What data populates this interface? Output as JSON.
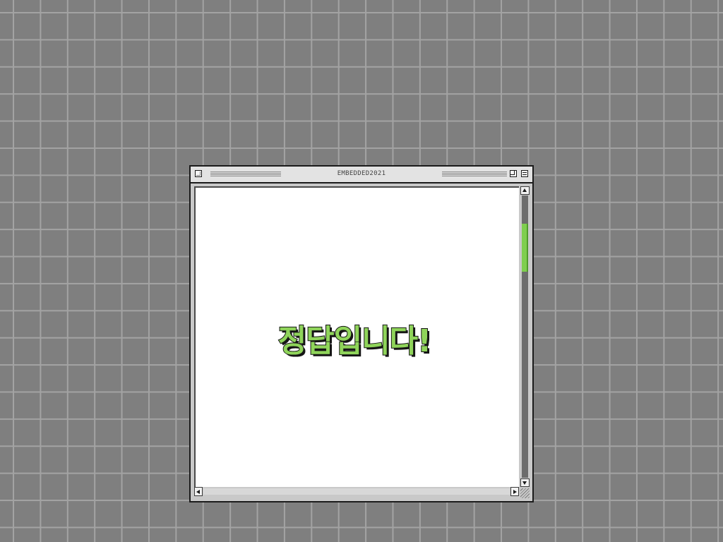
{
  "window": {
    "title": "EMBEDDED2021"
  },
  "content": {
    "message": "정답입니다!"
  },
  "scrollbar": {
    "vertical_position_fraction": 0.12,
    "vertical_visible_fraction": 0.17,
    "thumb_color": "#7fce4f"
  },
  "colors": {
    "desktop_background": "#7f7f7f",
    "grid_lines": "#a3a3a3",
    "message_fill": "#8fd45a",
    "message_outline": "#151515"
  },
  "icons": {
    "close": "close-box-icon",
    "zoom": "zoom-box-icon",
    "collapse": "collapse-box-icon",
    "scroll_up": "arrow-up-icon",
    "scroll_down": "arrow-down-icon",
    "scroll_left": "arrow-left-icon",
    "scroll_right": "arrow-right-icon",
    "resize": "resize-grip-icon"
  }
}
